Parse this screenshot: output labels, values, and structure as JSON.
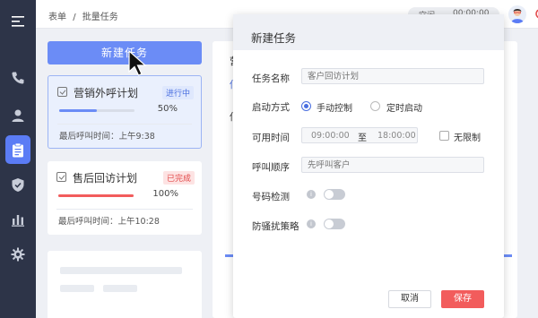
{
  "header": {
    "breadcrumb": [
      "表单",
      "/",
      "批量任务"
    ],
    "status": "空闲",
    "timer": "00:00:00"
  },
  "sidebar": {
    "icons": [
      "menu-icon",
      "phone-icon",
      "user-icon",
      "clipboard-icon",
      "shield-icon",
      "bar-chart-icon",
      "gear-icon"
    ],
    "active_index": 3
  },
  "list": {
    "new_button": "新建任务",
    "tasks": [
      {
        "title": "营销外呼计划",
        "badge": "进行中",
        "progress": 0.5,
        "percent": "50%",
        "meta": "最后呼叫时间：上午9:38"
      },
      {
        "title": "售后回访计划",
        "badge": "已完成",
        "progress": 1.0,
        "percent": "100%",
        "meta": "最后呼叫时间：上午10:28"
      }
    ]
  },
  "background": {
    "fragments": [
      "营",
      "佢",
      "佢"
    ]
  },
  "modal": {
    "title": "新建任务",
    "task_name_label": "任务名称",
    "task_name_placeholder": "客户回访计划",
    "start_mode_label": "启动方式",
    "start_manual": "手动控制",
    "start_timed": "定时启动",
    "time_label": "可用时间",
    "time_from": "09:00:00",
    "time_to_word": "至",
    "time_to": "18:00:00",
    "unlimited": "无限制",
    "order_label": "呼叫顺序",
    "order_placeholder": "先呼叫客户",
    "number_check_label": "号码检测",
    "anti_harass_label": "防骚扰策略",
    "cancel": "取消",
    "save": "保存"
  },
  "colors": {
    "accent": "#6b8cf6",
    "danger": "#f25c5c",
    "rail": "#2d3448"
  }
}
